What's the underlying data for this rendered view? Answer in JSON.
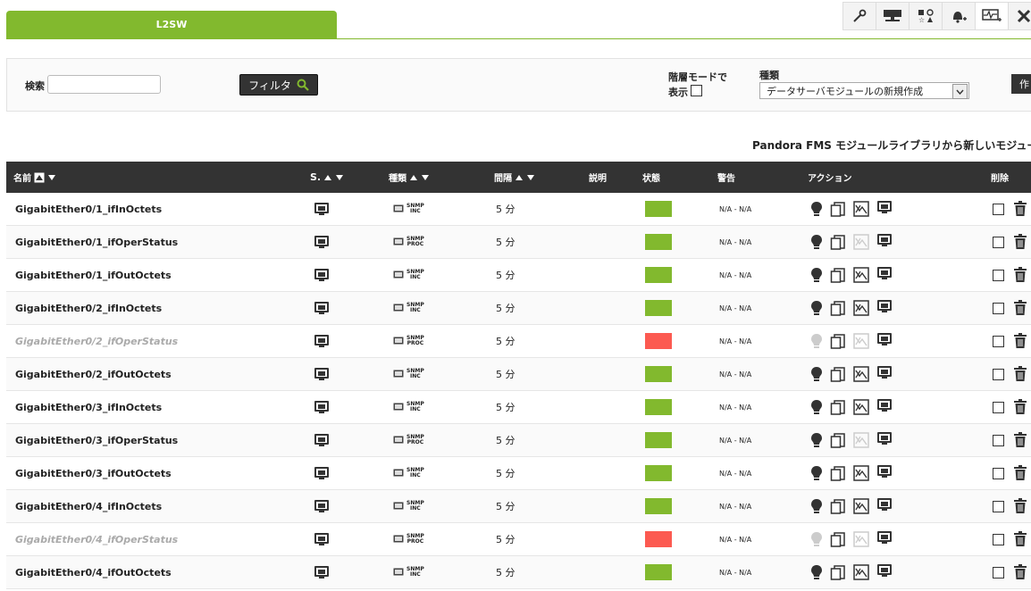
{
  "tab": {
    "label": "L2SW"
  },
  "filter": {
    "search_label": "検索",
    "search_value": "",
    "filter_button": "フィルタ",
    "hierarchy_label_1": "階層モードで",
    "hierarchy_label_2": "表示",
    "type_label": "種類",
    "type_selected": "データサーバモジュールの新規作成",
    "create_button": "作"
  },
  "library_link": "Pandora FMS モジュールライブラリから新しいモジュールを",
  "table": {
    "headers": {
      "name": "名前",
      "s": "S.",
      "type": "種類",
      "interval": "間隔",
      "description": "説明",
      "status": "状態",
      "warning": "警告",
      "action": "アクション",
      "delete": "削除"
    },
    "rows": [
      {
        "name": "GigabitEther0/1_ifInOctets",
        "snmp": "SNMP INC",
        "interval": "5 分",
        "status": "ok",
        "warn": "N/A - N/A",
        "disabled": false,
        "graph": true
      },
      {
        "name": "GigabitEther0/1_ifOperStatus",
        "snmp": "SNMP PROC",
        "interval": "5 分",
        "status": "ok",
        "warn": "N/A - N/A",
        "disabled": false,
        "graph": false
      },
      {
        "name": "GigabitEther0/1_ifOutOctets",
        "snmp": "SNMP INC",
        "interval": "5 分",
        "status": "ok",
        "warn": "N/A - N/A",
        "disabled": false,
        "graph": true
      },
      {
        "name": "GigabitEther0/2_ifInOctets",
        "snmp": "SNMP INC",
        "interval": "5 分",
        "status": "ok",
        "warn": "N/A - N/A",
        "disabled": false,
        "graph": true
      },
      {
        "name": "GigabitEther0/2_ifOperStatus",
        "snmp": "SNMP PROC",
        "interval": "5 分",
        "status": "critical",
        "warn": "N/A - N/A",
        "disabled": true,
        "graph": false
      },
      {
        "name": "GigabitEther0/2_ifOutOctets",
        "snmp": "SNMP INC",
        "interval": "5 分",
        "status": "ok",
        "warn": "N/A - N/A",
        "disabled": false,
        "graph": true
      },
      {
        "name": "GigabitEther0/3_ifInOctets",
        "snmp": "SNMP INC",
        "interval": "5 分",
        "status": "ok",
        "warn": "N/A - N/A",
        "disabled": false,
        "graph": true
      },
      {
        "name": "GigabitEther0/3_ifOperStatus",
        "snmp": "SNMP PROC",
        "interval": "5 分",
        "status": "ok",
        "warn": "N/A - N/A",
        "disabled": false,
        "graph": false
      },
      {
        "name": "GigabitEther0/3_ifOutOctets",
        "snmp": "SNMP INC",
        "interval": "5 分",
        "status": "ok",
        "warn": "N/A - N/A",
        "disabled": false,
        "graph": true
      },
      {
        "name": "GigabitEther0/4_ifInOctets",
        "snmp": "SNMP INC",
        "interval": "5 分",
        "status": "ok",
        "warn": "N/A - N/A",
        "disabled": false,
        "graph": true
      },
      {
        "name": "GigabitEther0/4_ifOperStatus",
        "snmp": "SNMP PROC",
        "interval": "5 分",
        "status": "critical",
        "warn": "N/A - N/A",
        "disabled": true,
        "graph": false
      },
      {
        "name": "GigabitEther0/4_ifOutOctets",
        "snmp": "SNMP INC",
        "interval": "5 分",
        "status": "ok",
        "warn": "N/A - N/A",
        "disabled": false,
        "graph": true
      }
    ]
  },
  "colors": {
    "accent": "#82b92e",
    "ok": "#82b92e",
    "critical": "#fc5a51",
    "header": "#333333"
  },
  "icons": [
    "wrench-icon",
    "monitor-network-icon",
    "shapes-icon",
    "bell-plus-icon",
    "monitor-pulse-icon",
    "tools-icon"
  ]
}
